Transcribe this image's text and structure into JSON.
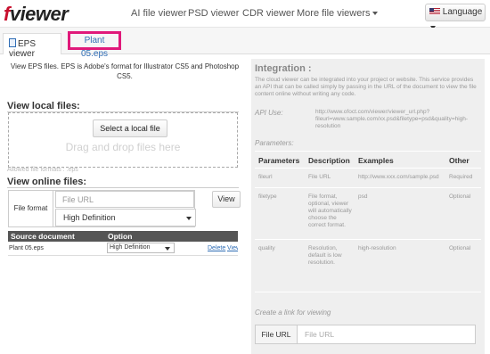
{
  "nav": {
    "logo_first": "f",
    "logo_rest": "viewer",
    "links": [
      "AI file viewer",
      "PSD viewer",
      "CDR viewer",
      "More file viewers"
    ],
    "language_label": "Language"
  },
  "tabs": {
    "tab1": "EPS viewer",
    "tab2": "Plant 05.eps"
  },
  "intro": "View EPS files. EPS is Adobe's format for Illustrator CS5 and Photoshop CS5.",
  "local": {
    "title": "View local files:",
    "select_button": "Select a local file",
    "drag_text": "Drag and drop files here",
    "allowed": "Allowed file formats : .eps"
  },
  "online": {
    "title": "View online files:",
    "file_format_label": "File format",
    "url_placeholder": "File URL",
    "quality_selected": "High Definition",
    "view_button": "View"
  },
  "table": {
    "headers": [
      "Source document",
      "Option"
    ],
    "row": {
      "name": "Plant 05.eps",
      "option": "High Definition",
      "delete": "Delete",
      "view": "View"
    }
  },
  "integration": {
    "title": "Integration :",
    "description": "The cloud viewer can be integrated into your project or website. This service provides an API that can be called simply by passing in the URL of the document to view the file content online without writing any code.",
    "api_label": "API Use:",
    "api_url": "http://www.ofoct.com/viewer/viewer_url.php?fileurl=www.sample.com/xx.psd&filetype=psd&quality=high-resolution",
    "params_label": "Parameters:",
    "headers": [
      "Parameters",
      "Description",
      "Examples",
      "Other"
    ],
    "rows": [
      {
        "param": "fileurl",
        "desc": "File URL",
        "example": "http://www.xxx.com/sample.psd",
        "other": "Required"
      },
      {
        "param": "filetype",
        "desc": "File format, optional, viewer will automatically choose the correct format.",
        "example": "psd",
        "other": "Optional"
      },
      {
        "param": "quality",
        "desc": "Resolution, default is low resolution.",
        "example": "high-resolution",
        "other": "Optional"
      }
    ],
    "create_link_label": "Create a link for viewing",
    "fileurl_label": "File URL",
    "fileurl_placeholder": "File URL"
  }
}
